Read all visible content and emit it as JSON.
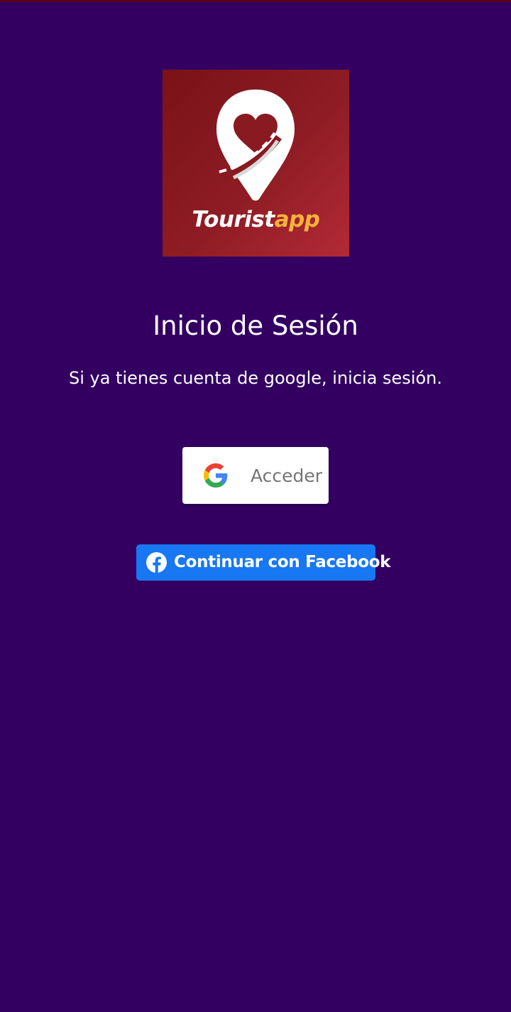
{
  "logo": {
    "text_primary": "Tourist",
    "text_accent": "app",
    "colors": {
      "background": "#8e1c24",
      "accent": "#f7b23b"
    }
  },
  "login": {
    "title": "Inicio de Sesión",
    "subtitle": "Si ya tienes cuenta de google, inicia sesión."
  },
  "google_button": {
    "label": "Acceder",
    "icon": "google-g-icon"
  },
  "facebook_button": {
    "label": "Continuar con Facebook",
    "icon": "facebook-icon",
    "color": "#1877f2"
  },
  "theme": {
    "background": "#330062"
  }
}
